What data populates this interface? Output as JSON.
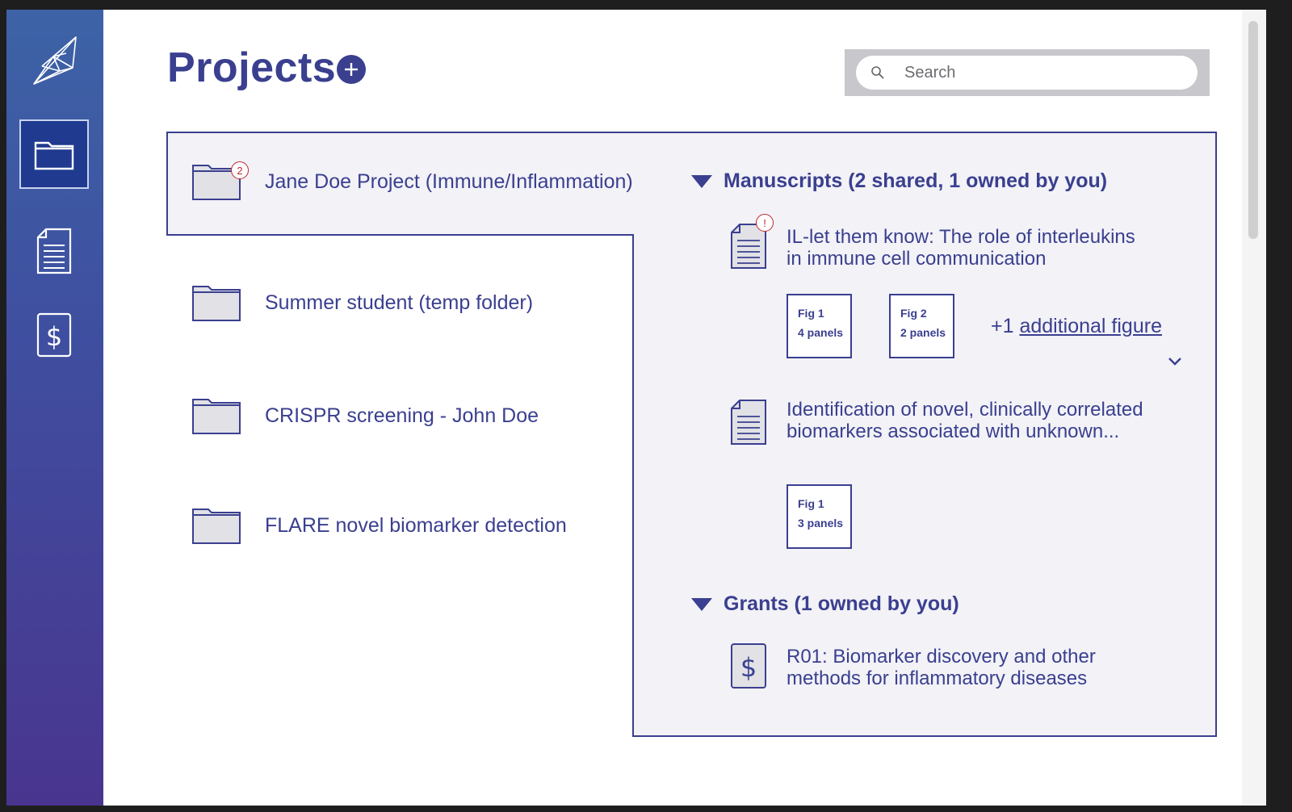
{
  "app": {
    "title": "Projects"
  },
  "sidebar": {
    "items": [
      {
        "name": "projects",
        "icon": "folder-icon",
        "active": true
      },
      {
        "name": "manuscripts",
        "icon": "document-icon",
        "active": false
      },
      {
        "name": "grants",
        "icon": "dollar-icon",
        "active": false
      }
    ]
  },
  "header": {
    "title": "Projects",
    "add_icon": "plus-icon"
  },
  "search": {
    "placeholder": "Search",
    "value": ""
  },
  "projects": [
    {
      "label": "Jane Doe Project (Immune/Inflammation)",
      "badge": "2",
      "selected": true
    },
    {
      "label": "Summer student (temp folder)"
    },
    {
      "label": "CRISPR screening - John Doe"
    },
    {
      "label": "FLARE novel biomarker detection"
    }
  ],
  "details": {
    "manuscripts": {
      "heading": "Manuscripts (2 shared, 1 owned by you)",
      "items": [
        {
          "title_line1": "IL-let them know: The role of interleukins",
          "title_line2": "in immune cell communication",
          "badge": "!",
          "figures": [
            {
              "name": "Fig 1",
              "panels": "4 panels"
            },
            {
              "name": "Fig 2",
              "panels": "2 panels"
            }
          ],
          "more_prefix": "+1 ",
          "more_link": "additional figure"
        },
        {
          "title_line1": "Identification of novel, clinically correlated",
          "title_line2": "biomarkers associated with unknown...",
          "figures": [
            {
              "name": "Fig 1",
              "panels": "3 panels"
            }
          ]
        }
      ]
    },
    "grants": {
      "heading": "Grants (1 owned by you)",
      "items": [
        {
          "title_line1": "R01: Biomarker discovery and other",
          "title_line2": "methods for inflammatory diseases"
        }
      ]
    }
  },
  "colors": {
    "accent": "#3a3f8f",
    "panel_bg": "#f2f2f7",
    "sidebar_top": "#3d63a6",
    "sidebar_bottom": "#49358f",
    "alert": "#c0262d"
  }
}
